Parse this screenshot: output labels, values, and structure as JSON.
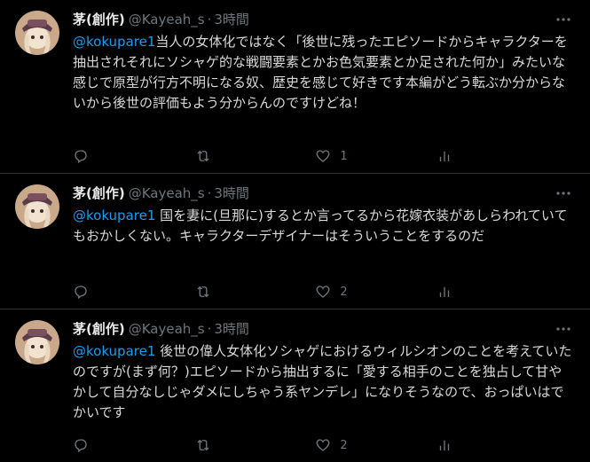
{
  "tweets": [
    {
      "display_name": "茅(創作)",
      "handle": "@Kayeah_s",
      "dot": "·",
      "time": "3時間",
      "mention": "@kokupare1",
      "body": "当人の女体化ではなく「後世に残ったエピソードからキャラクターを抽出されそれにソシャゲ的な戦闘要素とかお色気要素とか足された何か」みたいな感じで原型が行方不明になる奴、歴史を感じて好きです本編がどう転ぶか分からないから後世の評価もよう分からんのですけどね！",
      "reply_count": "",
      "retweet_count": "",
      "like_count": "1"
    },
    {
      "display_name": "茅(創作)",
      "handle": "@Kayeah_s",
      "dot": "·",
      "time": "3時間",
      "mention": "@kokupare1",
      "body": " 国を妻に(旦那に)するとか言ってるから花嫁衣装があしらわれていてもおかしくない。キャラクターデザイナーはそういうことをするのだ",
      "reply_count": "",
      "retweet_count": "",
      "like_count": "2"
    },
    {
      "display_name": "茅(創作)",
      "handle": "@Kayeah_s",
      "dot": "·",
      "time": "3時間",
      "mention": "@kokupare1",
      "body": " 後世の偉人女体化ソシャゲにおけるウィルシオンのことを考えていたのですが(まず何？)エピソードから抽出するに「愛する相手のことを独占して甘やかして自分なしじゃダメにしちゃう系ヤンデレ」になりそうなので、おっぱいはでかいです",
      "reply_count": "",
      "retweet_count": "",
      "like_count": "2"
    }
  ],
  "icons": {
    "avatar": "avatar-icon",
    "more": "more-dots-icon",
    "reply": "reply-icon",
    "retweet": "retweet-icon",
    "like": "heart-icon",
    "analytics": "analytics-icon"
  },
  "colors": {
    "background": "#000000",
    "mention": "#1d9bf0",
    "muted": "#6e767d",
    "text": "#d9d9d9",
    "divider": "#2f3336"
  }
}
